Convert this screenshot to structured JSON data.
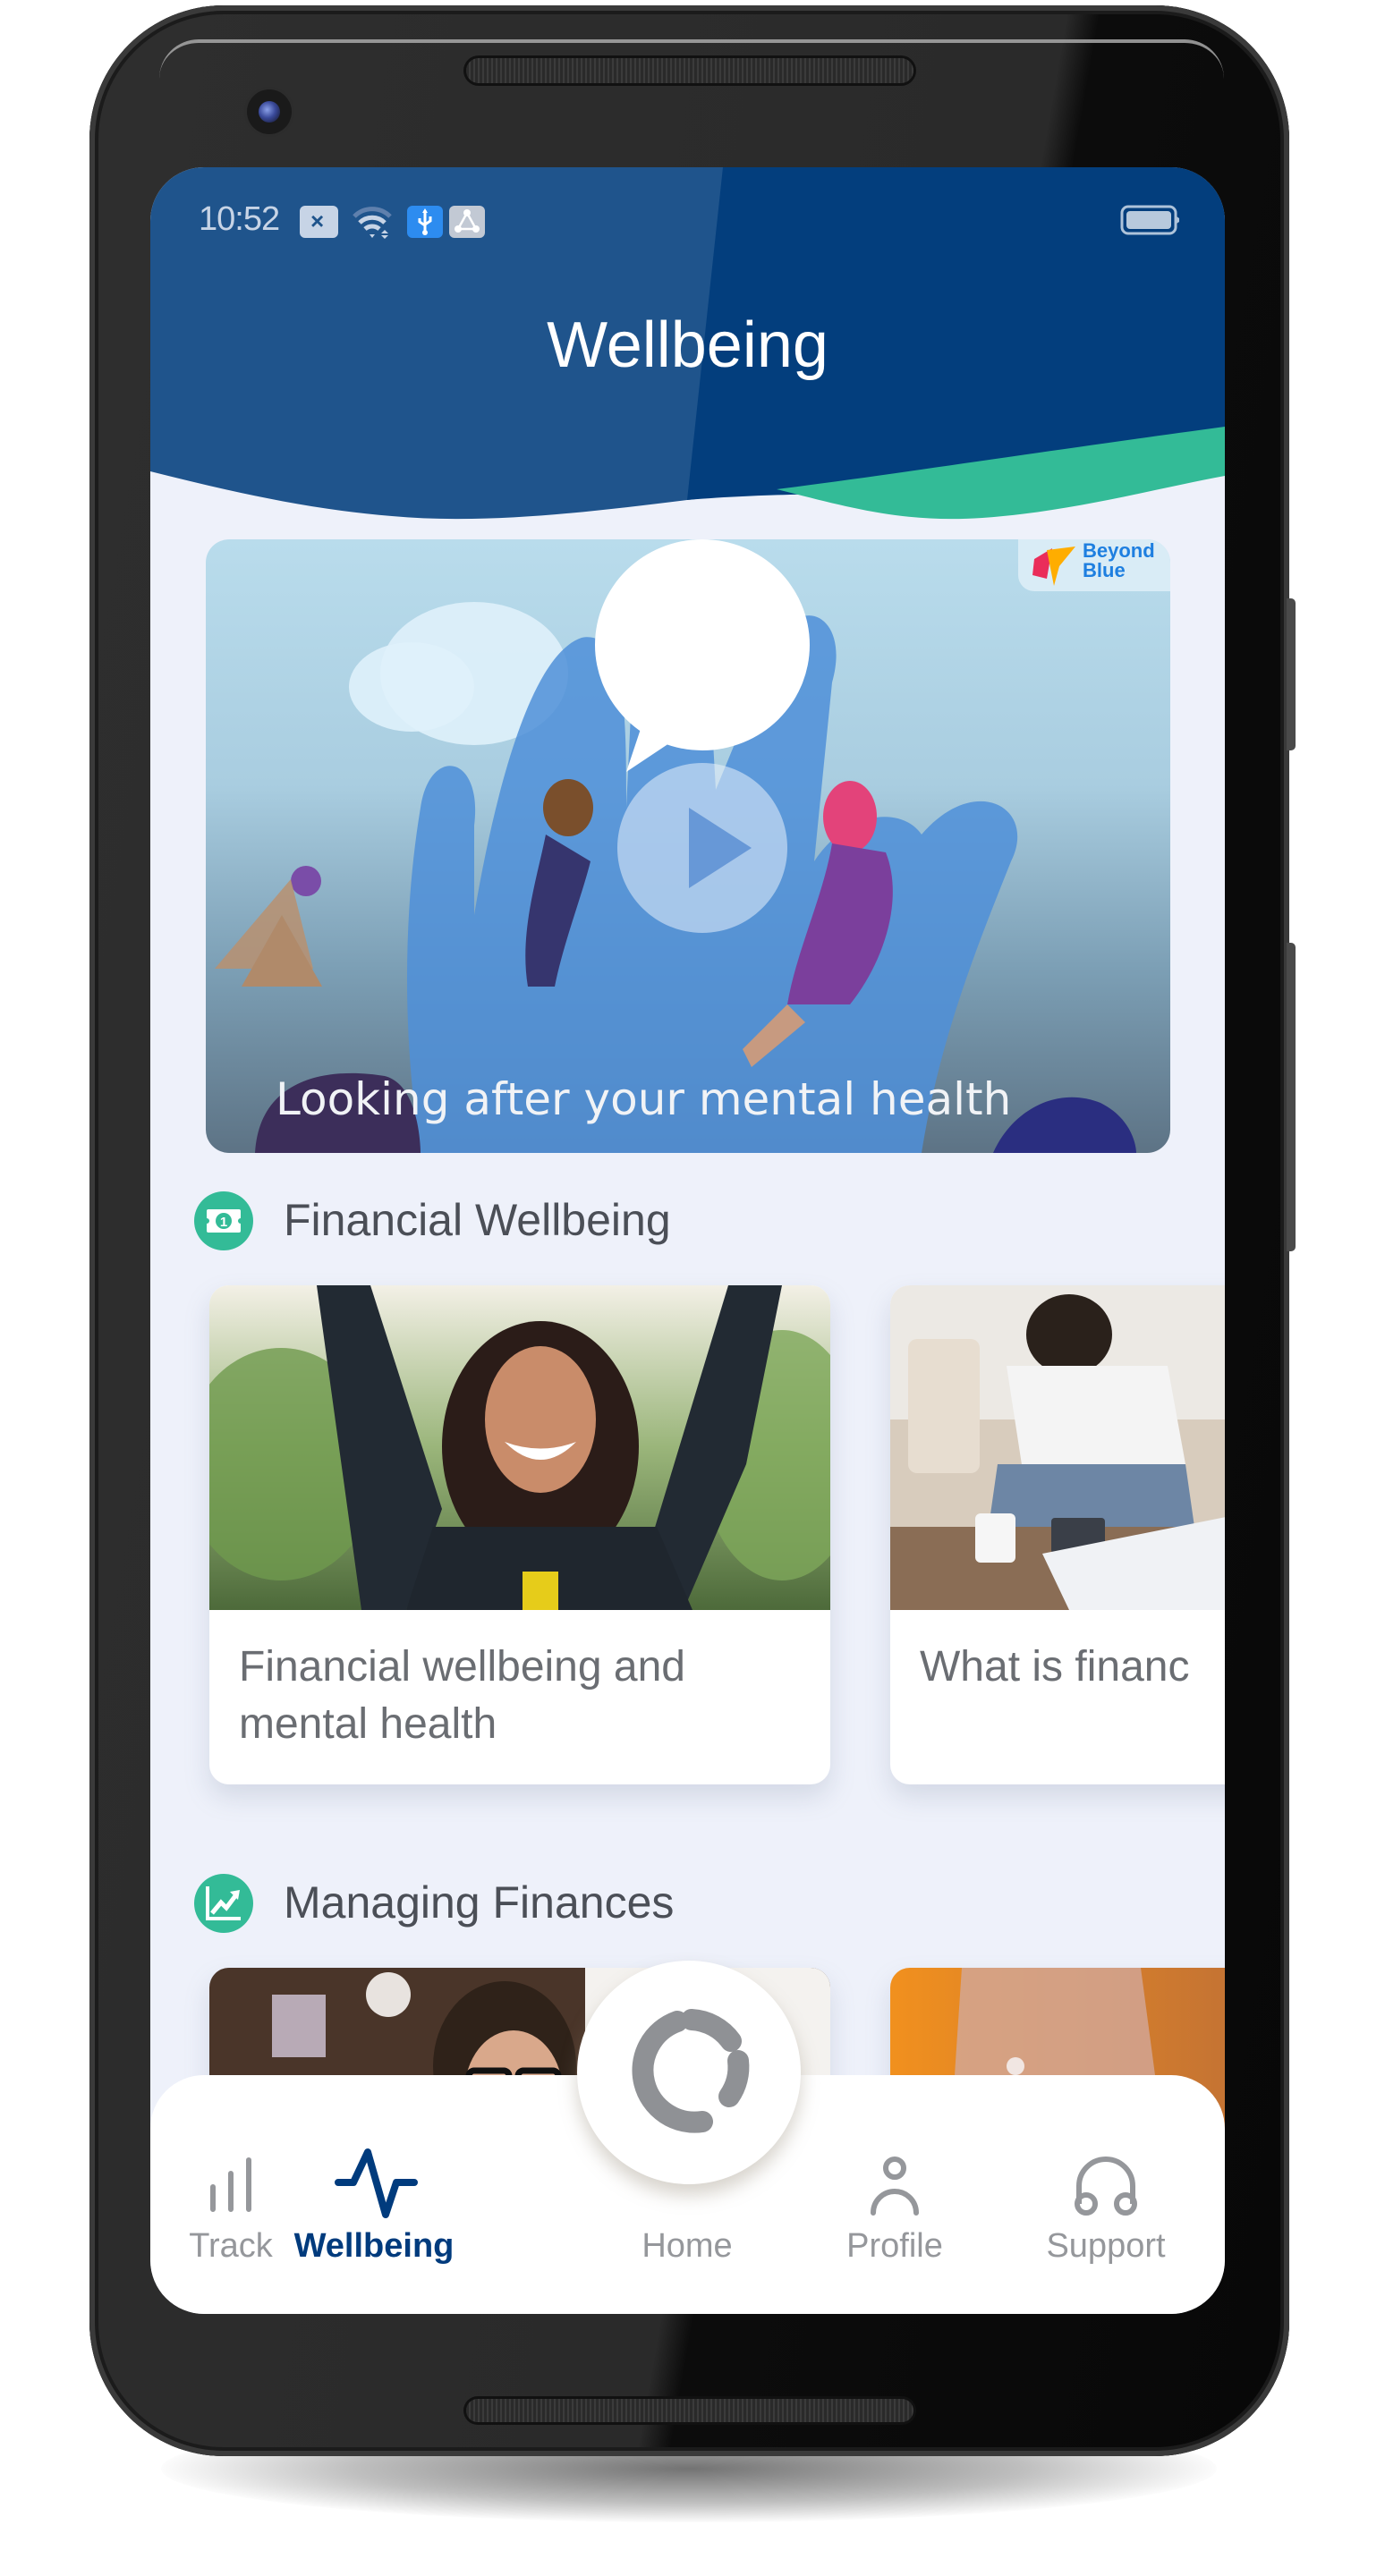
{
  "status_bar": {
    "time": "10:52",
    "icons": [
      "sim-error-icon",
      "wifi-icon",
      "usb-icon",
      "debug-share-icon",
      "battery-icon"
    ]
  },
  "header": {
    "title": "Wellbeing"
  },
  "colors": {
    "header_blue": "#1f548c",
    "header_dark_blue": "#033e7d",
    "accent_teal": "#33bb97",
    "active_nav": "#003b7d",
    "inactive_nav": "#95979b",
    "background": "#eef1fa"
  },
  "featured_video": {
    "caption": "Looking after your mental health",
    "badge": {
      "line1": "Beyond",
      "line2": "Blue"
    },
    "play_icon": "play-icon"
  },
  "sections": [
    {
      "title": "Financial Wellbeing",
      "icon": "banknote-icon",
      "cards": [
        {
          "title": "Financial wellbeing and mental health"
        },
        {
          "title": "What is financ"
        }
      ]
    },
    {
      "title": "Managing Finances",
      "icon": "trending-up-chart-icon",
      "cards": [
        {
          "title": ""
        },
        {
          "title": ""
        }
      ]
    }
  ],
  "bottom_nav": {
    "items": [
      {
        "label": "Track",
        "icon": "bar-chart-icon",
        "active": false
      },
      {
        "label": "Wellbeing",
        "icon": "pulse-icon",
        "active": true
      },
      {
        "label": "Home",
        "icon": "home-logo-icon",
        "active": false
      },
      {
        "label": "Profile",
        "icon": "person-icon",
        "active": false
      },
      {
        "label": "Support",
        "icon": "headphones-icon",
        "active": false
      }
    ]
  }
}
